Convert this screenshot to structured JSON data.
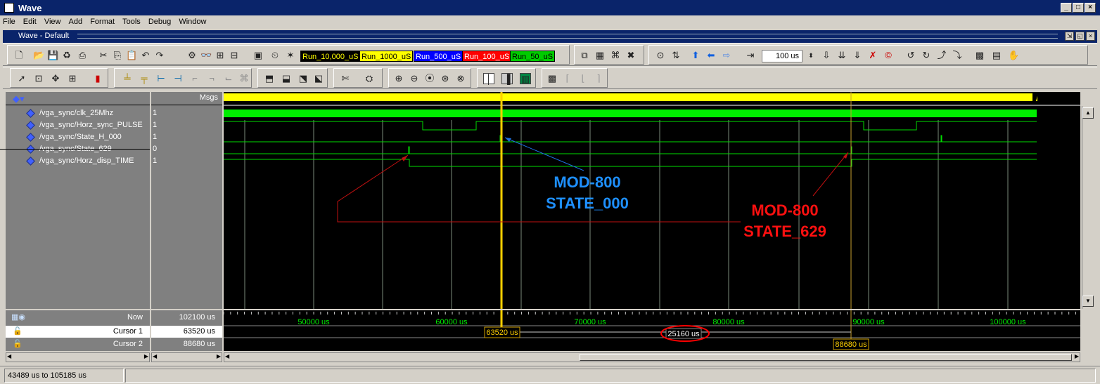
{
  "window": {
    "title": "Wave"
  },
  "menu": [
    "File",
    "Edit",
    "View",
    "Add",
    "Format",
    "Tools",
    "Debug",
    "Window"
  ],
  "subwindow": {
    "title": "Wave - Default"
  },
  "toolbar": {
    "run_buttons": [
      {
        "label": "Run_10,000_uS",
        "bg": "#000000",
        "fg": "#ffff00"
      },
      {
        "label": "Run_1000_uS",
        "bg": "#ffff00",
        "fg": "#000000"
      },
      {
        "label": "Run_500_uS",
        "bg": "#0000ff",
        "fg": "#ffffff"
      },
      {
        "label": "Run_100_uS",
        "bg": "#ff0000",
        "fg": "#ffffff"
      },
      {
        "label": "Run_50_uS",
        "bg": "#00cc00",
        "fg": "#000000"
      }
    ],
    "run_length": "100 us"
  },
  "wave": {
    "msgs_label": "Msgs",
    "signals": [
      {
        "name": "/vga_sync/clk_25Mhz",
        "value": "1"
      },
      {
        "name": "/vga_sync/Horz_sync_PULSE",
        "value": "1"
      },
      {
        "name": "/vga_sync/State_H_000",
        "value": "1"
      },
      {
        "name": "/vga_sync/State_629",
        "value": "0"
      },
      {
        "name": "/vga_sync/Horz_disp_TIME",
        "value": "1"
      }
    ],
    "annotations": [
      {
        "line1": "MOD-800",
        "line2": "STATE_000",
        "color": "#1e90ff"
      },
      {
        "line1": "MOD-800",
        "line2": "STATE_629",
        "color": "#ff1010"
      }
    ],
    "timeline": [
      "50000 us",
      "60000 us",
      "70000 us",
      "80000 us",
      "90000 us",
      "100000 us"
    ],
    "cursors": [
      {
        "label": "Now",
        "value": "102100 us"
      },
      {
        "label": "Cursor 1",
        "value": "63520 us"
      },
      {
        "label": "Cursor 2",
        "value": "88680 us"
      }
    ],
    "cursor1_time": "63520 us",
    "cursor2_time": "88680 us",
    "delta": "25160 us"
  },
  "status": {
    "range": "43489 us to 105185 us"
  }
}
